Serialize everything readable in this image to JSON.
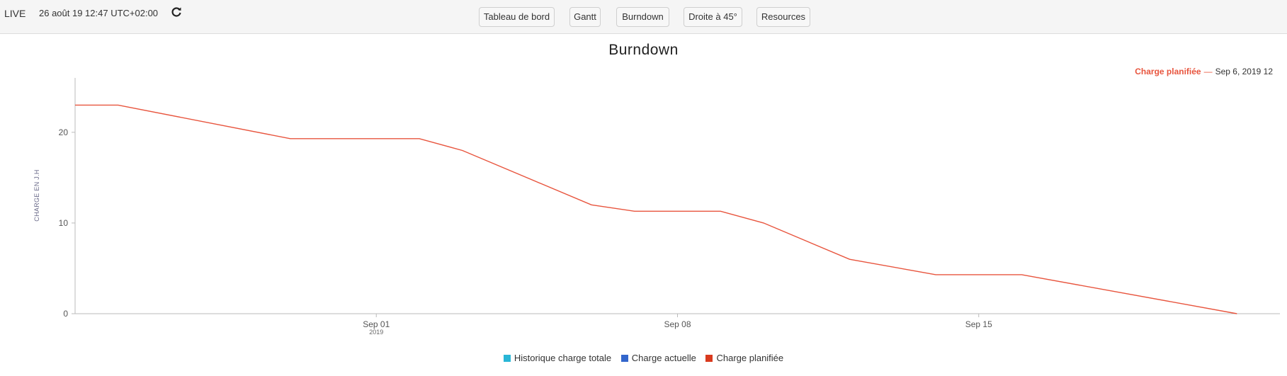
{
  "header": {
    "live_label": "LIVE",
    "timestamp": "26 août 19  12:47 UTC+02:00",
    "refresh_icon": "refresh-icon",
    "nav": [
      {
        "label": "Tableau de bord"
      },
      {
        "label": "Gantt"
      },
      {
        "label": "Burndown"
      },
      {
        "label": "Droite à 45°"
      },
      {
        "label": "Resources"
      }
    ]
  },
  "tooltip": {
    "series": "Charge planifiée",
    "separator": "—",
    "rest": "Sep  6, 2019  12"
  },
  "colors": {
    "planned": "#e8553e",
    "total_history": "#29b6d6",
    "current": "#3366cc",
    "planned_legend": "#d93a1e"
  },
  "chart_data": {
    "type": "line",
    "title": "Burndown",
    "ylabel": "CHARGE EN J.H",
    "xlabel": "",
    "ylim": [
      0,
      26
    ],
    "yticks": [
      0,
      10,
      20
    ],
    "xlim": [
      "2019-08-25",
      "2019-09-22"
    ],
    "xticks": [
      {
        "date": "2019-09-01",
        "label": "Sep 01",
        "sublabel": "2019"
      },
      {
        "date": "2019-09-08",
        "label": "Sep 08",
        "sublabel": ""
      },
      {
        "date": "2019-09-15",
        "label": "Sep 15",
        "sublabel": ""
      }
    ],
    "legend_position": "bottom",
    "legend": [
      "Historique charge totale",
      "Charge actuelle",
      "Charge planifiée"
    ],
    "series": [
      {
        "name": "Charge planifiée",
        "points": [
          {
            "x": "2019-08-25",
            "y": 23.0
          },
          {
            "x": "2019-08-26",
            "y": 23.0
          },
          {
            "x": "2019-08-30",
            "y": 19.3
          },
          {
            "x": "2019-09-02",
            "y": 19.3
          },
          {
            "x": "2019-09-03",
            "y": 18.0
          },
          {
            "x": "2019-09-06",
            "y": 12.0
          },
          {
            "x": "2019-09-07",
            "y": 11.3
          },
          {
            "x": "2019-09-09",
            "y": 11.3
          },
          {
            "x": "2019-09-10",
            "y": 10.0
          },
          {
            "x": "2019-09-12",
            "y": 6.0
          },
          {
            "x": "2019-09-14",
            "y": 4.3
          },
          {
            "x": "2019-09-16",
            "y": 4.3
          },
          {
            "x": "2019-09-21",
            "y": 0.0
          }
        ]
      }
    ]
  }
}
